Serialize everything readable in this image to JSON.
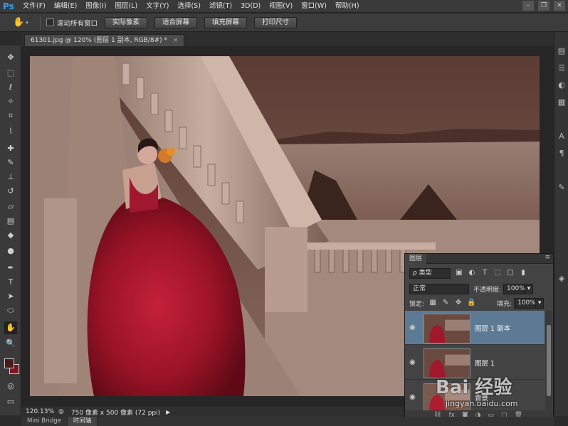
{
  "app": {
    "logo": "Ps"
  },
  "menu": {
    "items": [
      "文件(F)",
      "编辑(E)",
      "图像(I)",
      "图层(L)",
      "文字(Y)",
      "选择(S)",
      "滤镜(T)",
      "3D(D)",
      "视图(V)",
      "窗口(W)",
      "帮助(H)"
    ]
  },
  "window_controls": {
    "minimize": "–",
    "restore": "❐",
    "close": "✕"
  },
  "options_bar": {
    "tool_icon": "hand-icon",
    "scroll_all_label": "滚动所有窗口",
    "buttons": [
      "实际像素",
      "适合屏幕",
      "填充屏幕",
      "打印尺寸"
    ]
  },
  "document": {
    "tab_title": "61301.jpg @ 120% (图层 1 副本, RGB/8#) *",
    "tab_close": "×"
  },
  "status": {
    "zoom": "120.13%",
    "doc_info": "750 像素 x 500 像素 (72 ppi)",
    "arrow": "▶"
  },
  "bottom_tabs": [
    "Mini Bridge",
    "时间轴"
  ],
  "layers_panel": {
    "tab": "图层",
    "menu_icon": "≡",
    "filter_kind": "ρ 类型",
    "blend_mode": "正常",
    "opacity_label": "不透明度:",
    "opacity_value": "100%",
    "lock_label": "锁定:",
    "fill_label": "填充:",
    "fill_value": "100%",
    "layers": [
      {
        "name": "图层 1 副本",
        "selected": true
      },
      {
        "name": "图层 1",
        "selected": false
      },
      {
        "name": "背景",
        "selected": false
      }
    ],
    "footer_icons": [
      "link-icon",
      "fx-icon",
      "mask-icon",
      "adjustment-icon",
      "folder-icon",
      "new-layer-icon",
      "trash-icon"
    ],
    "footer_glyphs": [
      "⛓",
      "fx",
      "◙",
      "◑",
      "▭",
      "▢",
      "🗑"
    ]
  },
  "toolbox": {
    "tools": [
      {
        "name": "move-tool-icon",
        "glyph": "✥"
      },
      {
        "name": "marquee-tool-icon",
        "glyph": "⬚"
      },
      {
        "name": "lasso-tool-icon",
        "glyph": "ℓ"
      },
      {
        "name": "quick-select-tool-icon",
        "glyph": "✧"
      },
      {
        "name": "crop-tool-icon",
        "glyph": "⌗"
      },
      {
        "name": "eyedropper-tool-icon",
        "glyph": "⌇"
      },
      {
        "name": "healing-brush-tool-icon",
        "glyph": "✚"
      },
      {
        "name": "brush-tool-icon",
        "glyph": "✎"
      },
      {
        "name": "clone-stamp-tool-icon",
        "glyph": "⊥"
      },
      {
        "name": "history-brush-tool-icon",
        "glyph": "↺"
      },
      {
        "name": "eraser-tool-icon",
        "glyph": "▱"
      },
      {
        "name": "gradient-tool-icon",
        "glyph": "▤"
      },
      {
        "name": "blur-tool-icon",
        "glyph": "◆"
      },
      {
        "name": "dodge-tool-icon",
        "glyph": "●"
      },
      {
        "name": "pen-tool-icon",
        "glyph": "✒"
      },
      {
        "name": "type-tool-icon",
        "glyph": "T"
      },
      {
        "name": "path-select-tool-icon",
        "glyph": "➤"
      },
      {
        "name": "shape-tool-icon",
        "glyph": "⬭"
      },
      {
        "name": "hand-tool-icon",
        "glyph": "✋"
      },
      {
        "name": "zoom-tool-icon",
        "glyph": "🔍"
      }
    ]
  },
  "watermark": {
    "text": "Bai 经验",
    "url": "jingyan.baidu.com"
  },
  "colors": {
    "foreground": "#4a1a16",
    "background": "#7a1522",
    "selected_layer": "#5d7a94"
  }
}
